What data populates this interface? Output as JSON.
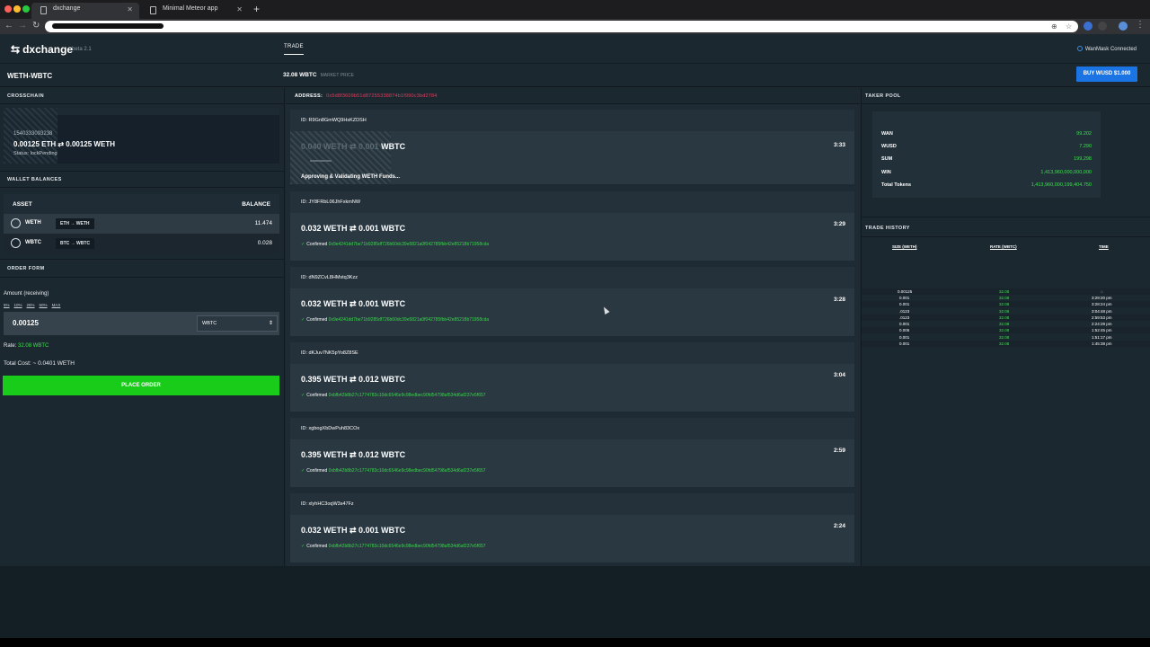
{
  "browser": {
    "tabs": [
      {
        "title": "dxchange",
        "active": true
      },
      {
        "title": "Minimal Meteor app",
        "active": false
      }
    ]
  },
  "app": {
    "logo": "dxchange",
    "beta": "beta 2.1",
    "nav_tab": "TRADE",
    "wallet_status": "WanMask Connected",
    "pair": "WETH-WBTC",
    "market_price": "32.08 WBTC",
    "market_price_label": "MARKET PRICE",
    "buy_button": "BUY WUSD $1.000"
  },
  "crosschain": {
    "title": "CROSSCHAIN",
    "id": "1540333093238",
    "amount": "0.00125 ETH ⇄ 0.00125 WETH",
    "status": "Status: lockPending"
  },
  "wallet": {
    "title": "WALLET BALANCES",
    "col_asset": "ASSET",
    "col_balance": "BALANCE",
    "rows": [
      {
        "symbol": "WETH",
        "convert": "ETH → WETH",
        "balance": "11.474"
      },
      {
        "symbol": "WBTC",
        "convert": "BTC → WBTC",
        "balance": "0.028"
      }
    ]
  },
  "order_form": {
    "title": "ORDER FORM",
    "amount_label": "Amount (receiving)",
    "percents": [
      "5%",
      "10%",
      "25%",
      "50%",
      "MAX"
    ],
    "amount_value": "0.00125",
    "asset": "WBTC",
    "rate_label": "Rate:",
    "rate_value": "32.08 WBTC",
    "total": "Total Cost: ~ 0.0401 WETH",
    "place_button": "PLACE ORDER"
  },
  "address": {
    "label": "ADDRESS:",
    "value": "0x5d8f3609b51d87255338874b1f990c3bd2784"
  },
  "trades": [
    {
      "id": "ID: R9Gn8GmWQ9HsKZDSH",
      "pending": true,
      "amount_dim": "0.040 WETH ⇄ 0.001",
      "amount_bright": " WBTC",
      "time": "3:33",
      "message": "Approving & Validating WETH Funds..."
    },
    {
      "id": "ID: JY8FRbL06JhFxkmNW",
      "amount": "0.032 WETH ⇄ 0.001 WBTC",
      "time": "3:29",
      "confirmed": "Confirmed",
      "hash": "0x9e4241dd7be71b9285df726b60dc39e5821a0f042785fbb42e85218b71958cda"
    },
    {
      "id": "ID: dN9ZCvL8HMstq3Kzz",
      "amount": "0.032 WETH ⇄ 0.001 WBTC",
      "time": "3:28",
      "confirmed": "Confirmed",
      "hash": "0x9e4241dd7be71b9285df726b60dc39e5821a0f042785fbb42e85218b71958cda"
    },
    {
      "id": "ID: dKJuv7NK5pYo8Z8SE",
      "amount": "0.395 WETH ⇄ 0.012 WBTC",
      "time": "3:04",
      "confirmed": "Confirmed",
      "hash": "0xbfb42b8b27c1774783c10dc6546e9c98edbec90fd54798af534d6af237e5f657"
    },
    {
      "id": "ID: xgbogXbDwPuh83COx",
      "amount": "0.395 WETH ⇄ 0.012 WBTC",
      "time": "2:59",
      "confirmed": "Confirmed",
      "hash": "0xbfb42b8b27c1774783c10dc6546e9c98edbec90fd54798af534d6af237e5f657"
    },
    {
      "id": "ID: xlyhHC3oqW3s47Fz",
      "amount": "0.032 WETH ⇄ 0.001 WBTC",
      "time": "2:24",
      "confirmed": "Confirmed",
      "hash": "0xbfb42b8b27c1774783c10dc6546e9c98edbec90fd54798af534d6af237e5f657"
    }
  ],
  "taker_pool": {
    "title": "TAKER POOL",
    "rows": [
      {
        "label": "WAN",
        "value": "99.202"
      },
      {
        "label": "WUSD",
        "value": "7.290"
      },
      {
        "label": "SUM",
        "value": "199,298"
      },
      {
        "label": "WIN",
        "value": "1,413,960,000,000,000"
      },
      {
        "label": "Total Tokens",
        "value": "1,413,960,000,199,404.750"
      }
    ]
  },
  "trade_history": {
    "title": "TRADE HISTORY",
    "col_size": "SIZE (WETH)",
    "col_rate": "RATE (WBTC)",
    "col_time": "TIME",
    "rows": [
      {
        "size": "0.00125",
        "rate": "32.08",
        "time": "◌"
      },
      {
        "size": "0.001",
        "rate": "32.08",
        "time": "3:29:20 pm"
      },
      {
        "size": "0.001",
        "rate": "32.08",
        "time": "3:28:24 pm"
      },
      {
        "size": ".0123",
        "rate": "32.08",
        "time": "3:04:48 pm"
      },
      {
        "size": ".0123",
        "rate": "32.08",
        "time": "2:59:53 pm"
      },
      {
        "size": "0.001",
        "rate": "32.08",
        "time": "2:24:29 pm"
      },
      {
        "size": "0.005",
        "rate": "32.08",
        "time": "1:52:45 pm"
      },
      {
        "size": "0.001",
        "rate": "32.08",
        "time": "1:51:17 pm"
      },
      {
        "size": "0.001",
        "rate": "32.08",
        "time": "1:45:38 pm"
      }
    ]
  },
  "colors": {
    "accent_green": "#39e24b",
    "buy_blue": "#1b74e4",
    "address_red": "#e53a5a"
  }
}
